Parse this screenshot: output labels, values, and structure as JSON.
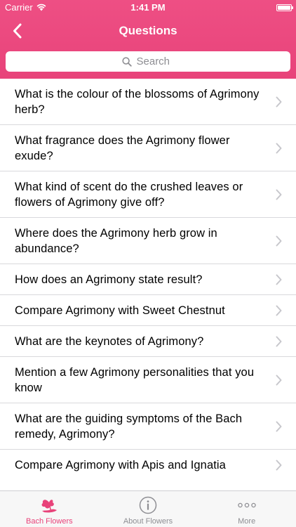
{
  "status_bar": {
    "carrier": "Carrier",
    "time": "1:41 PM"
  },
  "nav": {
    "title": "Questions",
    "back_icon": "chevron-left-icon"
  },
  "search": {
    "placeholder": "Search",
    "value": ""
  },
  "questions": [
    "What is the colour of the blossoms of Agrimony herb?",
    "What fragrance does the Agrimony flower exude?",
    "What kind of scent do the crushed leaves or flowers of Agrimony give off?",
    "Where does the Agrimony herb grow in abundance?",
    "How does an Agrimony state result?",
    "Compare Agrimony with Sweet Chestnut",
    "What are the keynotes of Agrimony?",
    "Mention a few Agrimony personalities that you know",
    "What are the guiding symptoms of the Bach remedy, Agrimony?",
    "Compare Agrimony with Apis and Ignatia"
  ],
  "tabs": [
    {
      "label": "Bach Flowers",
      "icon": "flower-icon",
      "active": true
    },
    {
      "label": "About Flowers",
      "icon": "info-icon",
      "active": false
    },
    {
      "label": "More",
      "icon": "more-icon",
      "active": false
    }
  ],
  "colors": {
    "accent": "#e8437a",
    "header_top": "#ee4f84",
    "tab_inactive": "#8e8e93",
    "separator": "#d9d9dc"
  }
}
